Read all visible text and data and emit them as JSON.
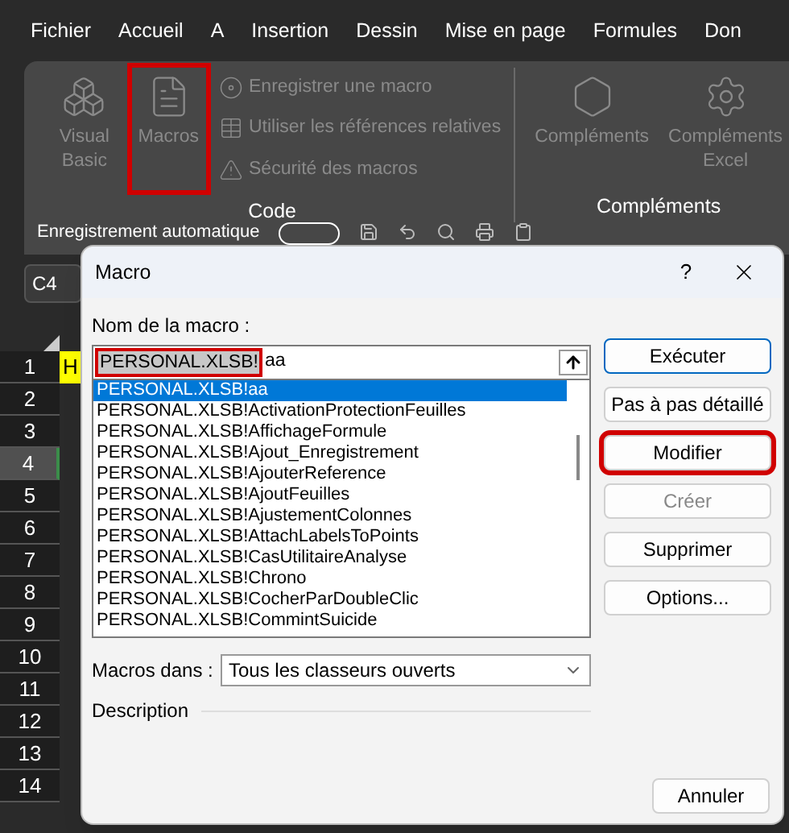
{
  "menu_tabs": [
    "Fichier",
    "Accueil",
    "A",
    "Insertion",
    "Dessin",
    "Mise en page",
    "Formules",
    "Don"
  ],
  "ribbon": {
    "groups": [
      {
        "label": "Code",
        "large_buttons": [
          {
            "label": "Visual Basic",
            "disabled": true,
            "highlighted": false
          },
          {
            "label": "Macros",
            "disabled": true,
            "highlighted": true
          }
        ],
        "small_buttons": [
          {
            "label": "Enregistrer une macro",
            "disabled": true
          },
          {
            "label": "Utiliser les références relatives",
            "disabled": true
          },
          {
            "label": "Sécurité des macros",
            "disabled": true
          }
        ]
      },
      {
        "label": "Compléments",
        "large_buttons": [
          {
            "label": "Compléments",
            "disabled": true,
            "highlighted": false
          },
          {
            "label": "Compléments Excel",
            "disabled": true,
            "highlighted": false
          }
        ]
      }
    ]
  },
  "quick_bar": {
    "label": "Enregistrement automatique",
    "autosave_on": false
  },
  "name_box": "C4",
  "rows": [
    {
      "label": "1",
      "selected": false
    },
    {
      "label": "2",
      "selected": false
    },
    {
      "label": "3",
      "selected": false
    },
    {
      "label": "4",
      "selected": true
    },
    {
      "label": "5",
      "selected": false
    },
    {
      "label": "6",
      "selected": false
    },
    {
      "label": "7",
      "selected": false
    },
    {
      "label": "8",
      "selected": false
    },
    {
      "label": "9",
      "selected": false
    },
    {
      "label": "10",
      "selected": false
    },
    {
      "label": "11",
      "selected": false
    },
    {
      "label": "12",
      "selected": false
    },
    {
      "label": "13",
      "selected": false
    },
    {
      "label": "14",
      "selected": false
    }
  ],
  "cell_a1": {
    "text": "H",
    "color": "#ffff00"
  },
  "dialog": {
    "title": "Macro",
    "help": "?",
    "name_label": "Nom de la macro :",
    "name_field": {
      "selected_text": "PERSONAL.XLSB!",
      "rest_text": "aa",
      "selected_part_highlighted": true
    },
    "macros": [
      {
        "name": "PERSONAL.XLSB!aa",
        "selected": true
      },
      {
        "name": "PERSONAL.XLSB!ActivationProtectionFeuilles",
        "selected": false
      },
      {
        "name": "PERSONAL.XLSB!AffichageFormule",
        "selected": false
      },
      {
        "name": "PERSONAL.XLSB!Ajout_Enregistrement",
        "selected": false
      },
      {
        "name": "PERSONAL.XLSB!AjouterReference",
        "selected": false
      },
      {
        "name": "PERSONAL.XLSB!AjoutFeuilles",
        "selected": false
      },
      {
        "name": "PERSONAL.XLSB!AjustementColonnes",
        "selected": false
      },
      {
        "name": "PERSONAL.XLSB!AttachLabelsToPoints",
        "selected": false
      },
      {
        "name": "PERSONAL.XLSB!CasUtilitaireAnalyse",
        "selected": false
      },
      {
        "name": "PERSONAL.XLSB!Chrono",
        "selected": false
      },
      {
        "name": "PERSONAL.XLSB!CocherParDoubleClic",
        "selected": false
      },
      {
        "name": "PERSONAL.XLSB!CommintSuicide",
        "selected": false
      }
    ],
    "buttons": [
      {
        "label": "Exécuter",
        "default": true,
        "disabled": false,
        "highlighted": false
      },
      {
        "label": "Pas à pas détaillé",
        "default": false,
        "disabled": false,
        "highlighted": false
      },
      {
        "label": "Modifier",
        "default": false,
        "disabled": false,
        "highlighted": true
      },
      {
        "label": "Créer",
        "default": false,
        "disabled": true,
        "highlighted": false
      },
      {
        "label": "Supprimer",
        "default": false,
        "disabled": false,
        "highlighted": false
      },
      {
        "label": "Options...",
        "default": false,
        "disabled": false,
        "highlighted": false
      }
    ],
    "macros_in_label": "Macros dans :",
    "macros_in_value": "Tous les classeurs ouverts",
    "description_label": "Description",
    "cancel": "Annuler"
  }
}
